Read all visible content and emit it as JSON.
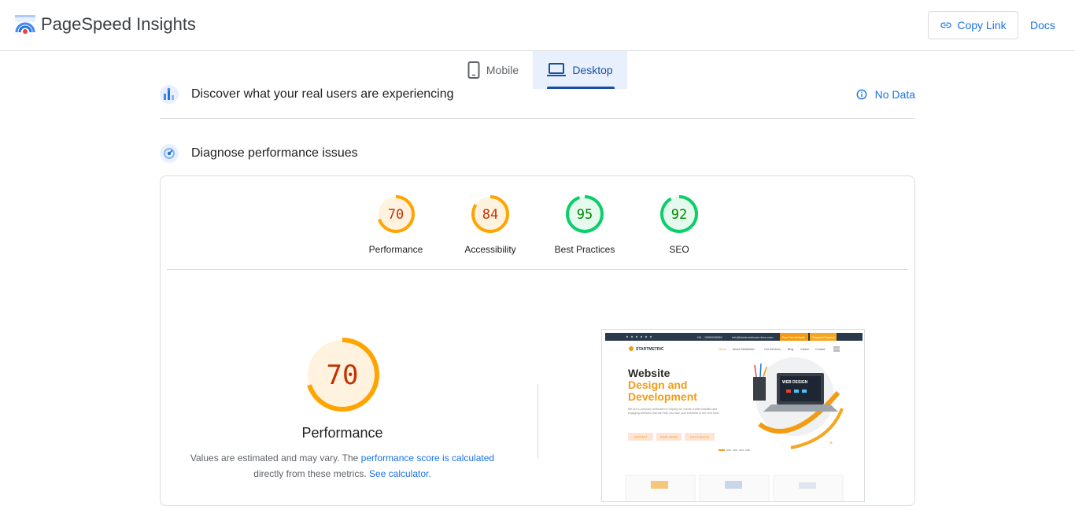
{
  "header": {
    "app_title": "PageSpeed Insights",
    "copy_link_label": "Copy Link",
    "docs_label": "Docs"
  },
  "tabs": [
    {
      "label": "Mobile",
      "active": false
    },
    {
      "label": "Desktop",
      "active": true
    }
  ],
  "sections": {
    "real_users_title": "Discover what your real users are experiencing",
    "no_data_label": "No Data",
    "diagnose_title": "Diagnose performance issues"
  },
  "scores": [
    {
      "label": "Performance",
      "value": "70",
      "fraction": 0.7,
      "status": "average"
    },
    {
      "label": "Accessibility",
      "value": "84",
      "fraction": 0.84,
      "status": "average"
    },
    {
      "label": "Best Practices",
      "value": "95",
      "fraction": 0.95,
      "status": "pass"
    },
    {
      "label": "SEO",
      "value": "92",
      "fraction": 0.92,
      "status": "pass"
    }
  ],
  "performance_detail": {
    "score": "70",
    "fraction": 0.7,
    "title": "Performance",
    "desc_part1": "Values are estimated and may vary. The ",
    "desc_link1": "performance score is calculated",
    "desc_part2": " directly from these metrics. ",
    "desc_link2": "See calculator."
  },
  "screenshot": {
    "top_bar_text": "+91 - 9999999999",
    "email_text": "info@startmetricservices.com",
    "btn_free": "Free Seo Analysis",
    "btn_proposal": "Request Proposal",
    "brand": "STARTMETRIC",
    "nav": [
      "Home",
      "About StartMetric",
      "Our Services",
      "Blog",
      "Career",
      "Contact"
    ],
    "hero_line1": "Website",
    "hero_line2": "Design and",
    "hero_line3": "Development",
    "hero_para": "We are a company dedicated to helping our clients create beautiful and engaging websites that can help you take your business to the next level.",
    "cta1": "CONTACT",
    "cta2": "READ MORE",
    "cta3": "GET A QUOTE",
    "laptop_label": "WEB DESIGN"
  },
  "colors": {
    "accent": "#1a73e8",
    "average": "#ffa400",
    "average_text": "#c33300",
    "average_bg": "#fff3e0",
    "pass": "#0cce6b",
    "pass_text": "#008800",
    "pass_bg": "#e6f9ee"
  }
}
